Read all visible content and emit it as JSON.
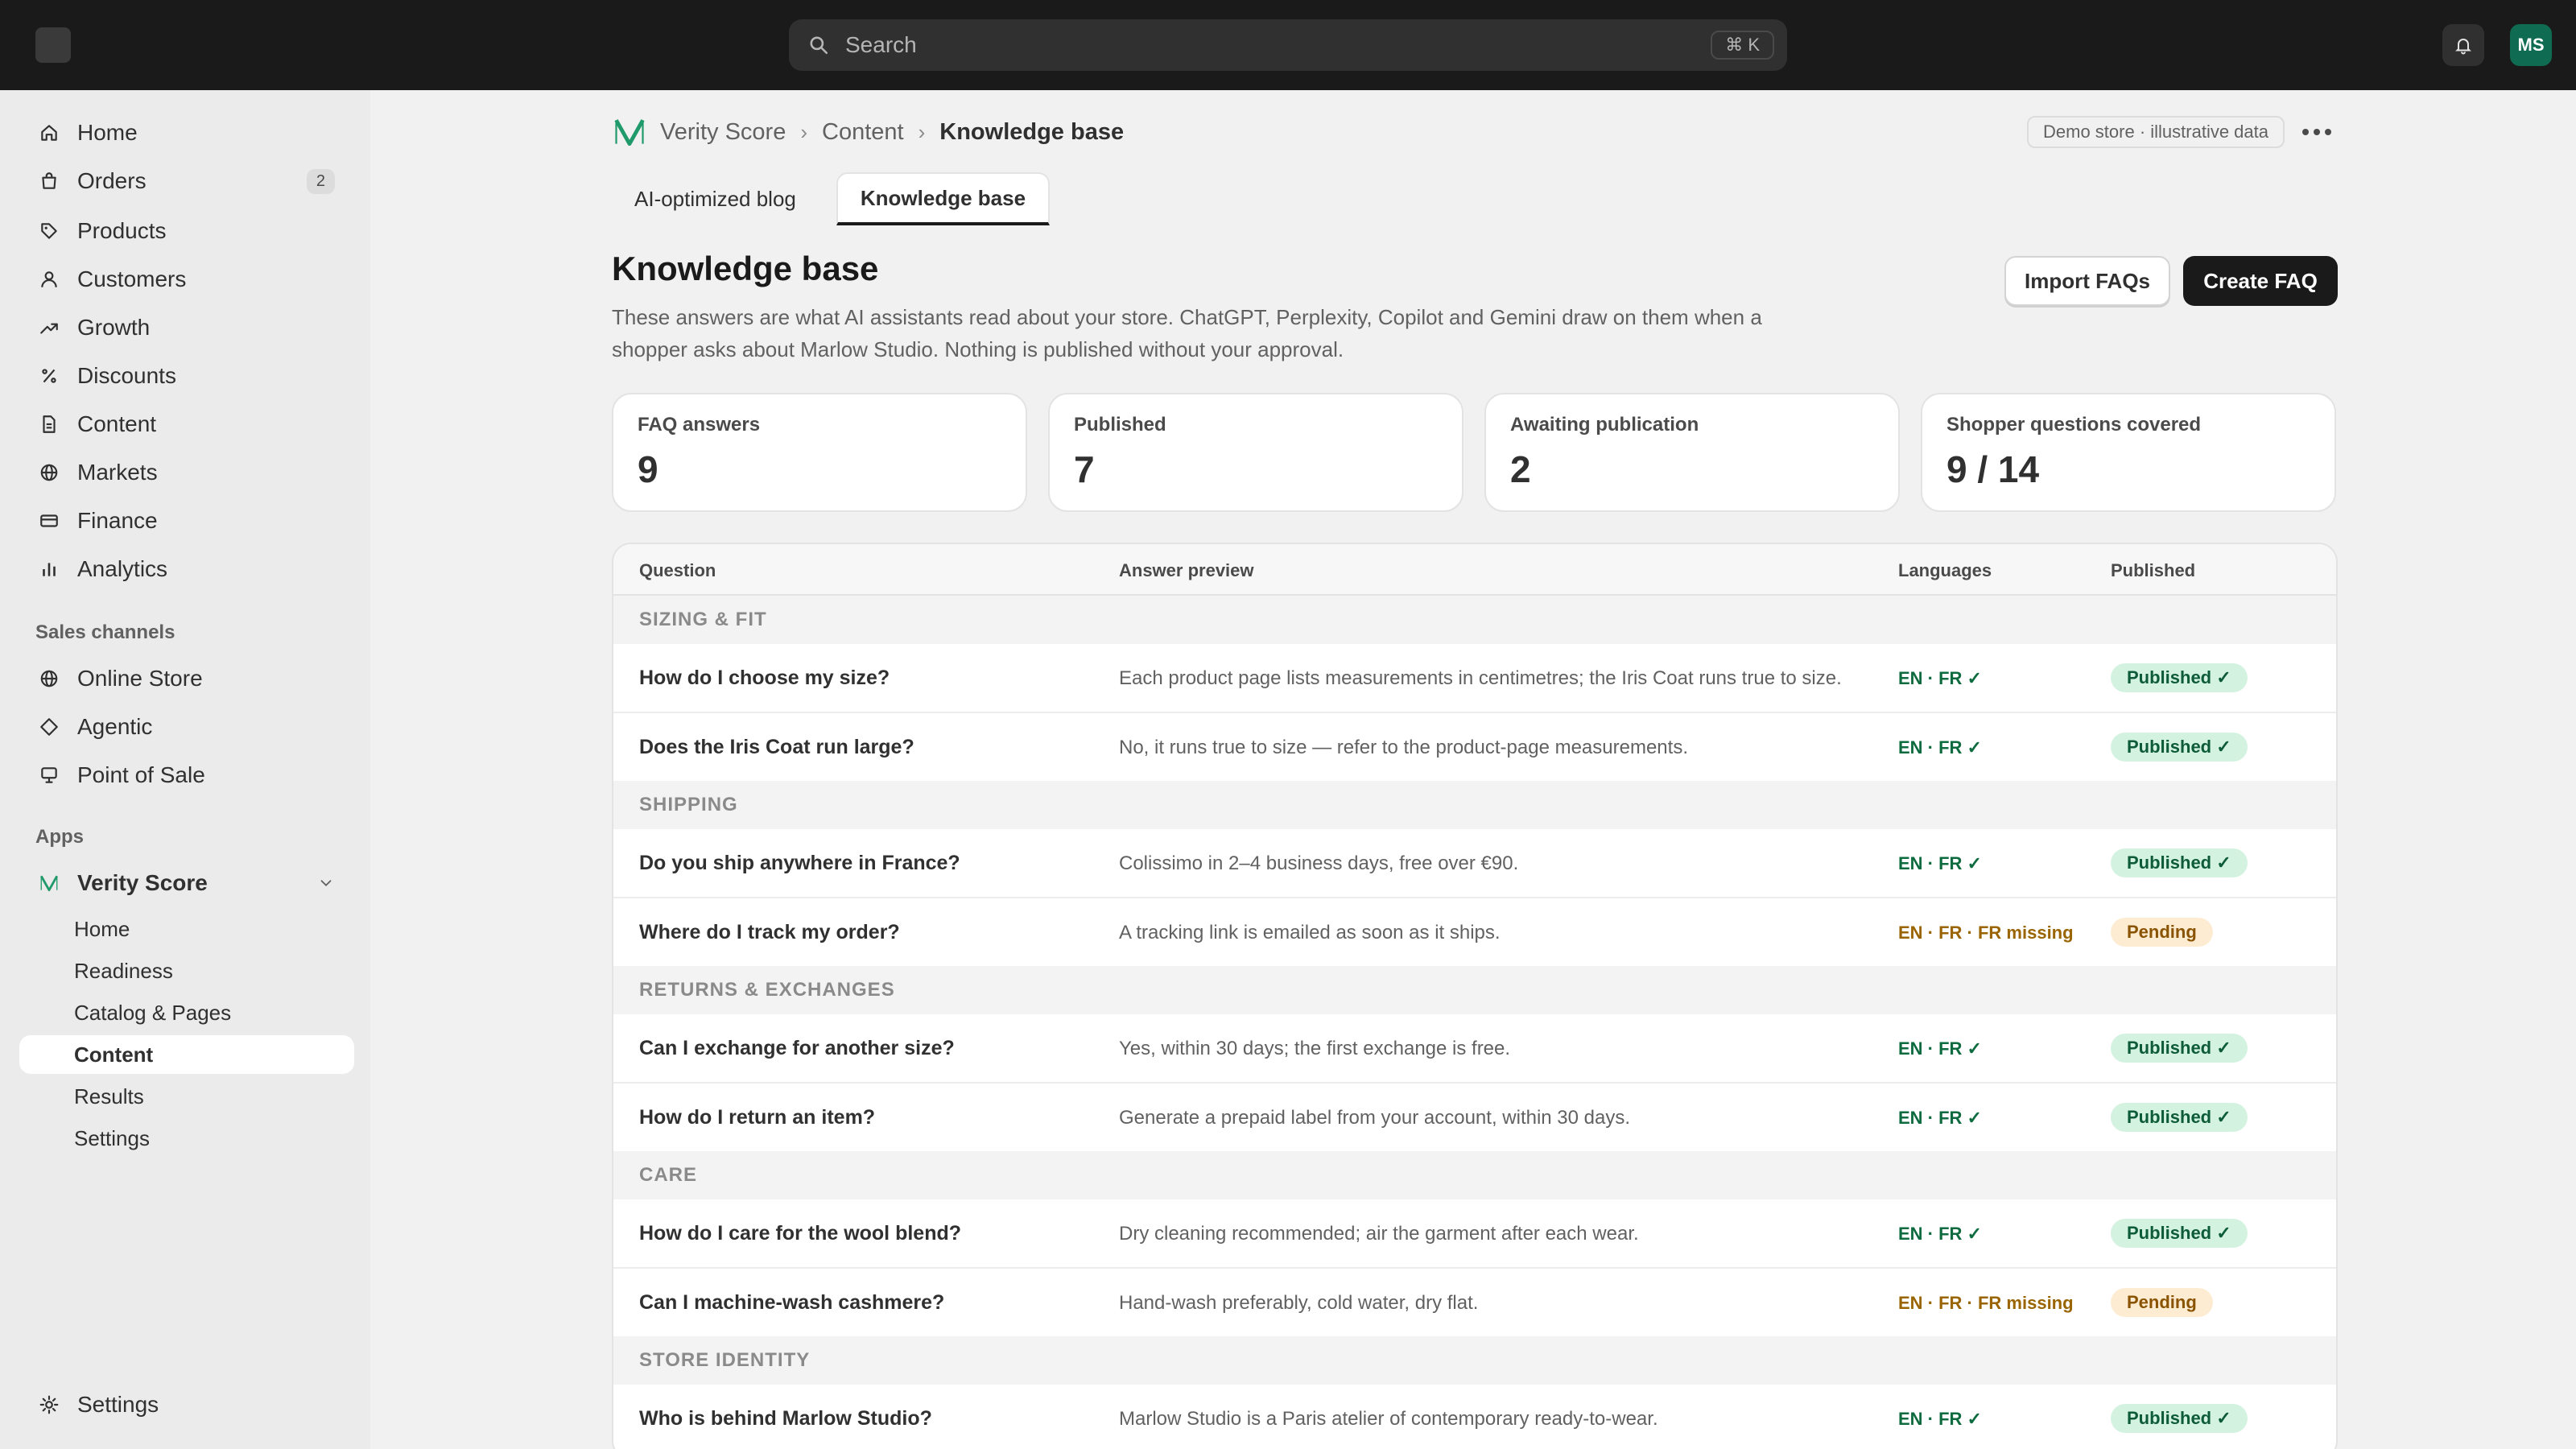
{
  "search": {
    "placeholder": "Search",
    "shortcut": "⌘ K"
  },
  "user": {
    "initials": "MS"
  },
  "sidebar": {
    "items": [
      {
        "label": "Home",
        "icon": "home-icon"
      },
      {
        "label": "Orders",
        "icon": "orders-icon",
        "badge": "2"
      },
      {
        "label": "Products",
        "icon": "tag-icon"
      },
      {
        "label": "Customers",
        "icon": "person-icon"
      },
      {
        "label": "Growth",
        "icon": "trend-icon"
      },
      {
        "label": "Discounts",
        "icon": "percent-icon"
      },
      {
        "label": "Content",
        "icon": "document-icon"
      },
      {
        "label": "Markets",
        "icon": "globe-icon"
      },
      {
        "label": "Finance",
        "icon": "card-icon"
      },
      {
        "label": "Analytics",
        "icon": "bar-chart-icon"
      }
    ],
    "sales_channels_title": "Sales channels",
    "channels": [
      {
        "label": "Online Store",
        "icon": "globe-icon"
      },
      {
        "label": "Agentic",
        "icon": "diamond-icon"
      },
      {
        "label": "Point of Sale",
        "icon": "pos-icon"
      }
    ],
    "apps_title": "Apps",
    "app": {
      "label": "Verity Score"
    },
    "app_sub": [
      "Home",
      "Readiness",
      "Catalog & Pages",
      "Content",
      "Results",
      "Settings"
    ],
    "settings": "Settings"
  },
  "breadcrumb": {
    "root": "Verity Score",
    "mid": "Content",
    "current": "Knowledge base",
    "sep": "›"
  },
  "demo_label": "Demo store · illustrative data",
  "tabs": [
    "AI-optimized blog",
    "Knowledge base"
  ],
  "page": {
    "title": "Knowledge base",
    "description": "These answers are what AI assistants read about your store. ChatGPT, Perplexity, Copilot and Gemini draw on them when a shopper asks about Marlow Studio. Nothing is published without your approval.",
    "import_label": "Import FAQs",
    "create_label": "Create FAQ"
  },
  "stats": [
    {
      "label": "FAQ answers",
      "value": "9"
    },
    {
      "label": "Published",
      "value": "7"
    },
    {
      "label": "Awaiting publication",
      "value": "2"
    },
    {
      "label": "Shopper questions covered",
      "value": "9 / 14"
    }
  ],
  "table": {
    "headers": [
      "Question",
      "Answer preview",
      "Languages",
      "Published"
    ],
    "groups": [
      {
        "title": "SIZING & FIT",
        "rows": [
          {
            "q": "How do I choose my size?",
            "a": "Each product page lists measurements in centimetres; the Iris Coat runs true to size.",
            "lang": "EN · FR ✓",
            "status": "Published ✓"
          },
          {
            "q": "Does the Iris Coat run large?",
            "a": "No, it runs true to size — refer to the product-page measurements.",
            "lang": "EN · FR ✓",
            "status": "Published ✓"
          }
        ]
      },
      {
        "title": "SHIPPING",
        "rows": [
          {
            "q": "Do you ship anywhere in France?",
            "a": "Colissimo in 2–4 business days, free over €90.",
            "lang": "EN · FR ✓",
            "status": "Published ✓"
          },
          {
            "q": "Where do I track my order?",
            "a": "A tracking link is emailed as soon as it ships.",
            "lang": "EN · FR · FR missing",
            "status": "Pending"
          }
        ]
      },
      {
        "title": "RETURNS & EXCHANGES",
        "rows": [
          {
            "q": "Can I exchange for another size?",
            "a": "Yes, within 30 days; the first exchange is free.",
            "lang": "EN · FR ✓",
            "status": "Published ✓"
          },
          {
            "q": "How do I return an item?",
            "a": "Generate a prepaid label from your account, within 30 days.",
            "lang": "EN · FR ✓",
            "status": "Published ✓"
          }
        ]
      },
      {
        "title": "CARE",
        "rows": [
          {
            "q": "How do I care for the wool blend?",
            "a": "Dry cleaning recommended; air the garment after each wear.",
            "lang": "EN · FR ✓",
            "status": "Published ✓"
          },
          {
            "q": "Can I machine-wash cashmere?",
            "a": "Hand-wash preferably, cold water, dry flat.",
            "lang": "EN · FR · FR missing",
            "status": "Pending"
          }
        ]
      },
      {
        "title": "STORE IDENTITY",
        "rows": [
          {
            "q": "Who is behind Marlow Studio?",
            "a": "Marlow Studio is a Paris atelier of contemporary ready-to-wear.",
            "lang": "EN · FR ✓",
            "status": "Published ✓"
          }
        ]
      }
    ]
  },
  "colors": {
    "accent": "#0f6b52",
    "published_bg": "#d3f2e0",
    "pending_bg": "#fdecd2"
  }
}
